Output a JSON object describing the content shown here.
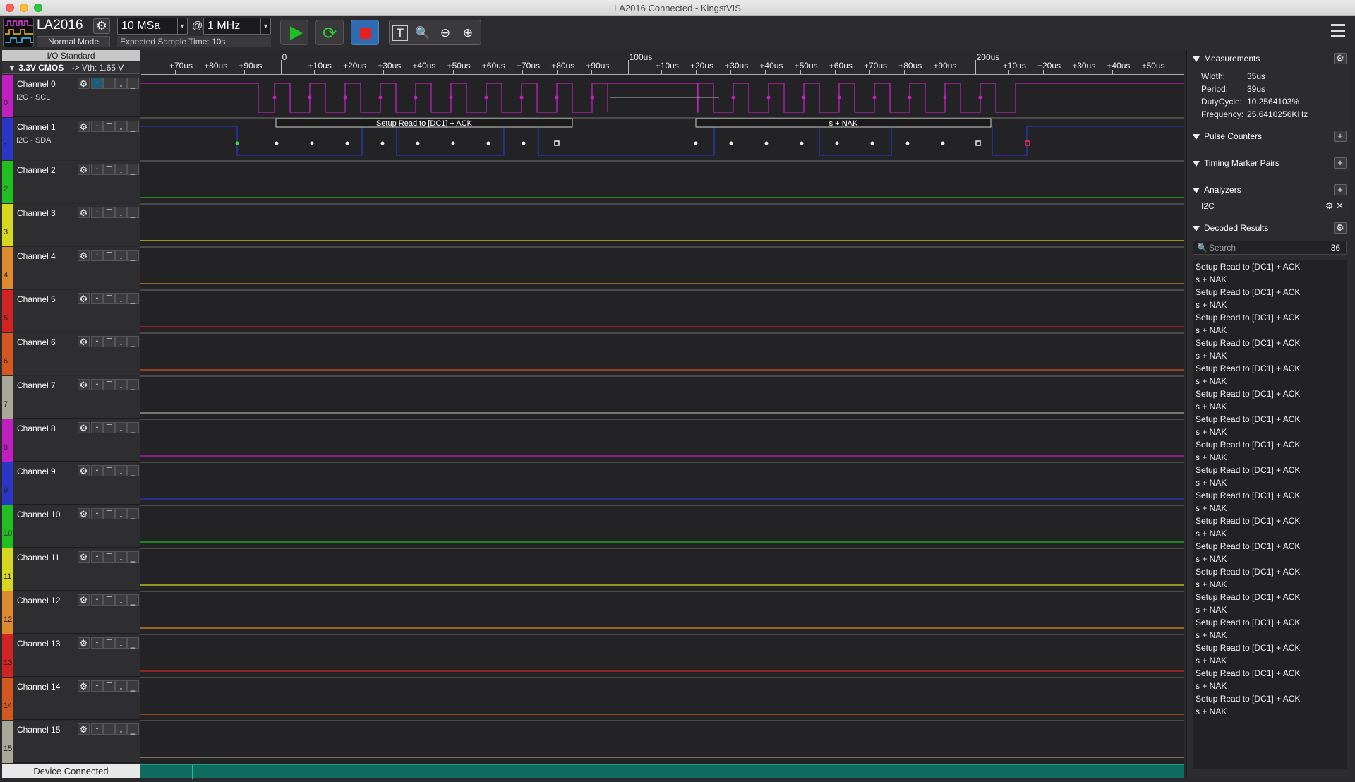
{
  "window": {
    "title": "LA2016 Connected - KingstVIS"
  },
  "toolbar": {
    "device_name": "LA2016",
    "device_mode": "Normal Mode",
    "sample_depth": "10 MSa",
    "at": "@",
    "sample_rate": "1 MHz",
    "expected_time": "Expected Sample Time: 10s"
  },
  "io": {
    "header": "I/O Standard",
    "standard": "3.3V CMOS",
    "vth": "-> Vth: 1.65 V"
  },
  "ruler": {
    "labels": [
      "+70us",
      "+80us",
      "+90us",
      "0",
      "+10us",
      "+20us",
      "+30us",
      "+40us",
      "+50us",
      "+60us",
      "+70us",
      "+80us",
      "+90us",
      "100us",
      "+10us",
      "+20us",
      "+30us",
      "+40us",
      "+50us",
      "+60us",
      "+70us",
      "+80us",
      "+90us",
      "200us",
      "+10us",
      "+20us",
      "+30us",
      "+40us",
      "+50us"
    ]
  },
  "channels": [
    {
      "name": "Channel 0",
      "sub": "I2C - SCL",
      "num": "0",
      "color": "#c21fc2"
    },
    {
      "name": "Channel 1",
      "sub": "I2C - SDA",
      "num": "1",
      "color": "#2a36c8"
    },
    {
      "name": "Channel 2",
      "sub": "",
      "num": "2",
      "color": "#1fbf1f"
    },
    {
      "name": "Channel 3",
      "sub": "",
      "num": "3",
      "color": "#d7d71f"
    },
    {
      "name": "Channel 4",
      "sub": "",
      "num": "4",
      "color": "#e08a30"
    },
    {
      "name": "Channel 5",
      "sub": "",
      "num": "5",
      "color": "#d22323"
    },
    {
      "name": "Channel 6",
      "sub": "",
      "num": "6",
      "color": "#d4571f"
    },
    {
      "name": "Channel 7",
      "sub": "",
      "num": "7",
      "color": "#a8a898"
    },
    {
      "name": "Channel 8",
      "sub": "",
      "num": "8",
      "color": "#c21fc2"
    },
    {
      "name": "Channel 9",
      "sub": "",
      "num": "9",
      "color": "#2a36c8"
    },
    {
      "name": "Channel 10",
      "sub": "",
      "num": "10",
      "color": "#1fbf1f"
    },
    {
      "name": "Channel 11",
      "sub": "",
      "num": "11",
      "color": "#d7d71f"
    },
    {
      "name": "Channel 12",
      "sub": "",
      "num": "12",
      "color": "#e08a30"
    },
    {
      "name": "Channel 13",
      "sub": "",
      "num": "13",
      "color": "#d22323"
    },
    {
      "name": "Channel 14",
      "sub": "",
      "num": "14",
      "color": "#d4571f"
    },
    {
      "name": "Channel 15",
      "sub": "",
      "num": "15",
      "color": "#a8a898"
    }
  ],
  "decode": {
    "frame1": "Setup Read to [DC1] + ACK",
    "frame2": "s + NAK"
  },
  "status": {
    "device": "Device Connected"
  },
  "panel": {
    "measurements": "Measurements",
    "width_k": "Width:",
    "width_v": "35us",
    "period_k": "Period:",
    "period_v": "39us",
    "duty_k": "DutyCycle:",
    "duty_v": "10.2564103%",
    "freq_k": "Frequency:",
    "freq_v": "25.6410256KHz",
    "pulse_counters": "Pulse Counters",
    "timing_pairs": "Timing Marker Pairs",
    "analyzers": "Analyzers",
    "analyzer_item": "I2C",
    "decoded_results": "Decoded Results",
    "search_placeholder": "Search",
    "result_count": "36"
  },
  "results": [
    "Setup Read to [DC1] + ACK",
    "s + NAK",
    "Setup Read to [DC1] + ACK",
    "s + NAK",
    "Setup Read to [DC1] + ACK",
    "s + NAK",
    "Setup Read to [DC1] + ACK",
    "s + NAK",
    "Setup Read to [DC1] + ACK",
    "s + NAK",
    "Setup Read to [DC1] + ACK",
    "s + NAK",
    "Setup Read to [DC1] + ACK",
    "s + NAK",
    "Setup Read to [DC1] + ACK",
    "s + NAK",
    "Setup Read to [DC1] + ACK",
    "s + NAK",
    "Setup Read to [DC1] + ACK",
    "s + NAK",
    "Setup Read to [DC1] + ACK",
    "s + NAK",
    "Setup Read to [DC1] + ACK",
    "s + NAK",
    "Setup Read to [DC1] + ACK",
    "s + NAK",
    "Setup Read to [DC1] + ACK",
    "s + NAK",
    "Setup Read to [DC1] + ACK",
    "s + NAK",
    "Setup Read to [DC1] + ACK",
    "s + NAK",
    "Setup Read to [DC1] + ACK",
    "s + NAK",
    "Setup Read to [DC1] + ACK",
    "s + NAK"
  ]
}
